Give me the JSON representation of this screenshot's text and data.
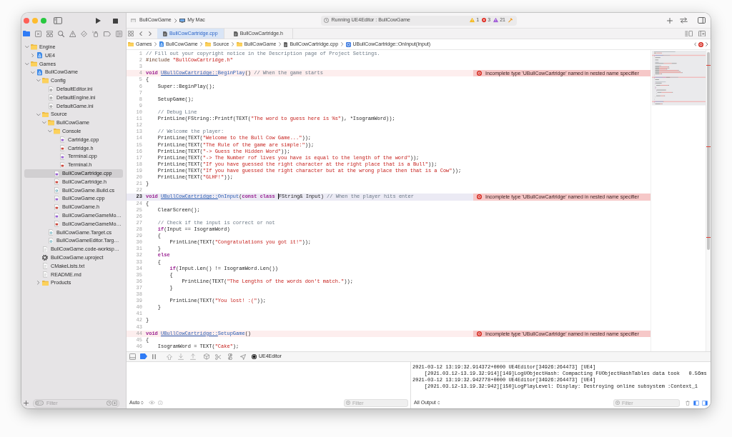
{
  "toolbar": {
    "scheme": "BullCowGame",
    "destination": "My Mac",
    "activity": {
      "status": "Running UE4Editor : BullCowGame",
      "warnings": "1",
      "errors": "3",
      "runtime_issues": "21"
    }
  },
  "navigator": {
    "tabs": [
      {
        "kind": "folder",
        "selected": true
      },
      {
        "kind": "source-control",
        "selected": false
      },
      {
        "kind": "symbols",
        "selected": false
      },
      {
        "kind": "find",
        "selected": false
      },
      {
        "kind": "issues",
        "selected": false
      },
      {
        "kind": "tests",
        "selected": false
      },
      {
        "kind": "debug",
        "selected": false
      },
      {
        "kind": "breakpoints",
        "selected": false
      },
      {
        "kind": "reports",
        "selected": false
      }
    ],
    "tree": [
      {
        "label": "Engine",
        "kind": "folder",
        "expanded": true,
        "selected": false,
        "children": [
          {
            "label": "UE4",
            "kind": "project",
            "expanded": false,
            "selected": false
          }
        ]
      },
      {
        "label": "Games",
        "kind": "folder",
        "expanded": true,
        "selected": false,
        "children": [
          {
            "label": "BullCowGame",
            "kind": "project",
            "expanded": true,
            "selected": false,
            "children": [
              {
                "label": "Config",
                "kind": "folder",
                "expanded": true,
                "selected": false,
                "children": [
                  {
                    "label": "DefaultEditor.ini",
                    "kind": "settings",
                    "selected": false
                  },
                  {
                    "label": "DefaultEngine.ini",
                    "kind": "settings",
                    "selected": false
                  },
                  {
                    "label": "DefaultGame.ini",
                    "kind": "settings",
                    "selected": false
                  }
                ]
              },
              {
                "label": "Source",
                "kind": "folder",
                "expanded": true,
                "selected": false,
                "children": [
                  {
                    "label": "BullCowGame",
                    "kind": "folder",
                    "expanded": true,
                    "selected": false,
                    "children": [
                      {
                        "label": "Console",
                        "kind": "folder",
                        "expanded": true,
                        "selected": false,
                        "children": [
                          {
                            "label": "Cartridge.cpp",
                            "kind": "source",
                            "selected": false
                          },
                          {
                            "label": "Cartridge.h",
                            "kind": "header",
                            "selected": false
                          },
                          {
                            "label": "Terminal.cpp",
                            "kind": "source",
                            "selected": false
                          },
                          {
                            "label": "Terminal.h",
                            "kind": "header",
                            "selected": false
                          }
                        ]
                      },
                      {
                        "label": "BullCowCartridge.cpp",
                        "kind": "source",
                        "selected": true
                      },
                      {
                        "label": "BullCowCartridge.h",
                        "kind": "header",
                        "selected": false
                      },
                      {
                        "label": "BullCowGame.Build.cs",
                        "kind": "csharp",
                        "selected": false
                      },
                      {
                        "label": "BullCowGame.cpp",
                        "kind": "source",
                        "selected": false
                      },
                      {
                        "label": "BullCowGame.h",
                        "kind": "header",
                        "selected": false
                      },
                      {
                        "label": "BullCowGameGameMo…",
                        "kind": "source",
                        "selected": false
                      },
                      {
                        "label": "BullCowGameGameMo…",
                        "kind": "header",
                        "selected": false
                      }
                    ]
                  },
                  {
                    "label": "BullCowGame.Target.cs",
                    "kind": "csharp",
                    "selected": false
                  },
                  {
                    "label": "BullCowGameEditor.Targ…",
                    "kind": "csharp",
                    "selected": false
                  }
                ]
              },
              {
                "label": "BullCowGame.code-worksp…",
                "kind": "document",
                "selected": false
              },
              {
                "label": "BullCowGame.uproject",
                "kind": "gear",
                "selected": false
              },
              {
                "label": "CMakeLists.txt",
                "kind": "document",
                "selected": false
              },
              {
                "label": "README.md",
                "kind": "document",
                "selected": false
              },
              {
                "label": "Products",
                "kind": "folder",
                "expanded": false,
                "selected": false
              }
            ]
          }
        ]
      }
    ],
    "filter": {
      "placeholder": "Filter"
    }
  },
  "editor": {
    "tabs": [
      {
        "label": "BullCowCartridge.cpp",
        "selected": true
      },
      {
        "label": "BullCowCartridge.h",
        "selected": false
      }
    ],
    "jump_bar": [
      {
        "label": "Games",
        "kind": "folder"
      },
      {
        "label": "BullCowGame",
        "kind": "project"
      },
      {
        "label": "Source",
        "kind": "folder"
      },
      {
        "label": "BullCowGame",
        "kind": "folder"
      },
      {
        "label": "BullCowCartridge.cpp",
        "kind": "source"
      },
      {
        "label": "UBullCowCartridge::OnInput(Input)",
        "kind": "method"
      }
    ],
    "lines": [
      {
        "number": "1",
        "current": false,
        "segments": [
          {
            "kind": "comment",
            "text": "// Fill out your copyright notice in the Description page of Project Settings."
          }
        ]
      },
      {
        "number": "2",
        "current": false,
        "segments": [
          {
            "kind": "preprocessor",
            "text": "#include "
          },
          {
            "kind": "string",
            "text": "\"BullCowCartridge.h\""
          }
        ]
      },
      {
        "number": "3",
        "current": false
      },
      {
        "number": "4",
        "current": false,
        "error": "Incomplete type 'UBullCowCartridge' named in nested name specifier",
        "segments": [
          {
            "kind": "keyword",
            "text": "void "
          },
          {
            "kind": "unresolved",
            "text": "UBullCowCartridge::"
          },
          {
            "kind": "method",
            "text": "BeginPlay"
          },
          {
            "kind": "plain",
            "text": "() "
          },
          {
            "kind": "comment",
            "text": "// When the game starts"
          }
        ]
      },
      {
        "number": "5",
        "current": false,
        "segments": [
          {
            "kind": "plain",
            "text": "{"
          }
        ]
      },
      {
        "number": "6",
        "current": false,
        "segments": [
          {
            "kind": "plain",
            "text": "    Super::BeginPlay();"
          }
        ]
      },
      {
        "number": "7",
        "current": false
      },
      {
        "number": "8",
        "current": false,
        "segments": [
          {
            "kind": "plain",
            "text": "    SetupGame();"
          }
        ]
      },
      {
        "number": "9",
        "current": false
      },
      {
        "number": "10",
        "current": false,
        "segments": [
          {
            "kind": "comment",
            "text": "    // Debug Line"
          }
        ]
      },
      {
        "number": "11",
        "current": false,
        "segments": [
          {
            "kind": "plain",
            "text": "    PrintLine(FString::Printf(TEXT("
          },
          {
            "kind": "string",
            "text": "\"The word to guess here is %s\""
          },
          {
            "kind": "plain",
            "text": "), *IsogramWord));"
          }
        ]
      },
      {
        "number": "12",
        "current": false
      },
      {
        "number": "13",
        "current": false,
        "segments": [
          {
            "kind": "comment",
            "text": "    // Welcome the player:"
          }
        ]
      },
      {
        "number": "14",
        "current": false,
        "segments": [
          {
            "kind": "plain",
            "text": "    PrintLine(TEXT("
          },
          {
            "kind": "string",
            "text": "\"Welcome to the Bull Cow Game...\""
          },
          {
            "kind": "plain",
            "text": "));"
          }
        ]
      },
      {
        "number": "15",
        "current": false,
        "segments": [
          {
            "kind": "plain",
            "text": "    PrintLine(TEXT("
          },
          {
            "kind": "string",
            "text": "\"The Rule of the game are simple:\""
          },
          {
            "kind": "plain",
            "text": "));"
          }
        ]
      },
      {
        "number": "16",
        "current": false,
        "segments": [
          {
            "kind": "plain",
            "text": "    PrintLine(TEXT("
          },
          {
            "kind": "string",
            "text": "\"-> Guess the Hidden Word\""
          },
          {
            "kind": "plain",
            "text": "));"
          }
        ]
      },
      {
        "number": "17",
        "current": false,
        "segments": [
          {
            "kind": "plain",
            "text": "    PrintLine(TEXT("
          },
          {
            "kind": "string",
            "text": "\"-> The Number rof lives you have is equal to the length of the word\""
          },
          {
            "kind": "plain",
            "text": "));"
          }
        ]
      },
      {
        "number": "18",
        "current": false,
        "segments": [
          {
            "kind": "plain",
            "text": "    PrintLine(TEXT("
          },
          {
            "kind": "string",
            "text": "\"If you have guessed the right character at the right place that is a Bull\""
          },
          {
            "kind": "plain",
            "text": "));"
          }
        ]
      },
      {
        "number": "19",
        "current": false,
        "segments": [
          {
            "kind": "plain",
            "text": "    PrintLine(TEXT("
          },
          {
            "kind": "string",
            "text": "\"If you have guessed the right character but at the wrong place then that is a Cow\""
          },
          {
            "kind": "plain",
            "text": "));"
          }
        ]
      },
      {
        "number": "20",
        "current": false,
        "segments": [
          {
            "kind": "plain",
            "text": "    PrintLine(TEXT("
          },
          {
            "kind": "string",
            "text": "\"GLHF!\""
          },
          {
            "kind": "plain",
            "text": "));"
          }
        ]
      },
      {
        "number": "21",
        "current": false,
        "segments": [
          {
            "kind": "plain",
            "text": "}"
          }
        ]
      },
      {
        "number": "22",
        "current": false
      },
      {
        "number": "23",
        "current": true,
        "error": "Incomplete type 'UBullCowCartridge' named in nested name specifier",
        "segments": [
          {
            "kind": "keyword",
            "text": "void "
          },
          {
            "kind": "unresolved",
            "text": "UBullCowCartridge::"
          },
          {
            "kind": "method",
            "text": "OnInput"
          },
          {
            "kind": "plain",
            "text": "("
          },
          {
            "kind": "keyword",
            "text": "const class "
          },
          {
            "kind": "caret"
          },
          {
            "kind": "plain",
            "text": "FString& Input) "
          },
          {
            "kind": "comment",
            "text": "// When the player hits enter"
          }
        ]
      },
      {
        "number": "24",
        "current": false,
        "segments": [
          {
            "kind": "plain",
            "text": "{"
          }
        ]
      },
      {
        "number": "25",
        "current": false,
        "segments": [
          {
            "kind": "plain",
            "text": "    ClearScreen();"
          }
        ]
      },
      {
        "number": "26",
        "current": false
      },
      {
        "number": "27",
        "current": false,
        "segments": [
          {
            "kind": "comment",
            "text": "    // Check if the input is correct or not"
          }
        ]
      },
      {
        "number": "28",
        "current": false,
        "segments": [
          {
            "kind": "keyword",
            "text": "    if"
          },
          {
            "kind": "plain",
            "text": "(Input == IsogramWord)"
          }
        ]
      },
      {
        "number": "29",
        "current": false,
        "segments": [
          {
            "kind": "plain",
            "text": "    {"
          }
        ]
      },
      {
        "number": "30",
        "current": false,
        "segments": [
          {
            "kind": "plain",
            "text": "        PrintLine(TEXT("
          },
          {
            "kind": "string",
            "text": "\"Congratulations you got it!\""
          },
          {
            "kind": "plain",
            "text": "));"
          }
        ]
      },
      {
        "number": "31",
        "current": false,
        "segments": [
          {
            "kind": "plain",
            "text": "    }"
          }
        ]
      },
      {
        "number": "32",
        "current": false,
        "segments": [
          {
            "kind": "keyword",
            "text": "    else"
          }
        ]
      },
      {
        "number": "33",
        "current": false,
        "segments": [
          {
            "kind": "plain",
            "text": "    {"
          }
        ]
      },
      {
        "number": "34",
        "current": false,
        "segments": [
          {
            "kind": "keyword",
            "text": "        if"
          },
          {
            "kind": "plain",
            "text": "(Input.Len() != IsogramWord.Len())"
          }
        ]
      },
      {
        "number": "35",
        "current": false,
        "segments": [
          {
            "kind": "plain",
            "text": "        {"
          }
        ]
      },
      {
        "number": "36",
        "current": false,
        "segments": [
          {
            "kind": "plain",
            "text": "            PrintLine(TEXT("
          },
          {
            "kind": "string",
            "text": "\"The Lengths of the words don't match.\""
          },
          {
            "kind": "plain",
            "text": "));"
          }
        ]
      },
      {
        "number": "37",
        "current": false,
        "segments": [
          {
            "kind": "plain",
            "text": "        }"
          }
        ]
      },
      {
        "number": "38",
        "current": false
      },
      {
        "number": "39",
        "current": false,
        "segments": [
          {
            "kind": "plain",
            "text": "        PrintLine(TEXT("
          },
          {
            "kind": "string",
            "text": "\"You lost! :(\""
          },
          {
            "kind": "plain",
            "text": "));"
          }
        ]
      },
      {
        "number": "40",
        "current": false,
        "segments": [
          {
            "kind": "plain",
            "text": "    }"
          }
        ]
      },
      {
        "number": "41",
        "current": false
      },
      {
        "number": "42",
        "current": false,
        "segments": [
          {
            "kind": "plain",
            "text": "}"
          }
        ]
      },
      {
        "number": "43",
        "current": false
      },
      {
        "number": "44",
        "current": false,
        "error": "Incomplete type 'UBullCowCartridge' named in nested name specifier",
        "segments": [
          {
            "kind": "keyword",
            "text": "void "
          },
          {
            "kind": "unresolved",
            "text": "UBullCowCartridge::"
          },
          {
            "kind": "method",
            "text": "SetupGame"
          },
          {
            "kind": "plain",
            "text": "()"
          }
        ]
      },
      {
        "number": "45",
        "current": false,
        "segments": [
          {
            "kind": "plain",
            "text": "{"
          }
        ]
      },
      {
        "number": "46",
        "current": false,
        "segments": [
          {
            "kind": "plain",
            "text": "    IsogramWord = TEXT("
          },
          {
            "kind": "string",
            "text": "\"Cake\""
          },
          {
            "kind": "plain",
            "text": ");"
          }
        ]
      }
    ]
  },
  "debug_bar": {
    "breakpoints_active": true,
    "process": "UE4Editor"
  },
  "variables": {
    "scope": "Auto",
    "filter": {
      "placeholder": "Filter"
    }
  },
  "console": {
    "lines": [
      "2021-03-12 13:19:32.914372+0000 UE4Editor[34926:264473] [UE4]",
      "    [2021.03.12-13.19.32:914][149]LogUObjectHash: Compacting FUObjectHashTables data took   0.56ms",
      "2021-03-12 13:19:32.942778+0000 UE4Editor[34926:264473] [UE4]",
      "    [2021.03.12-13.19.32:942][150]LogPlayLevel: Display: Destroying online subsystem :Context_1"
    ],
    "output": "All Output",
    "filter": {
      "placeholder": "Filter"
    }
  }
}
